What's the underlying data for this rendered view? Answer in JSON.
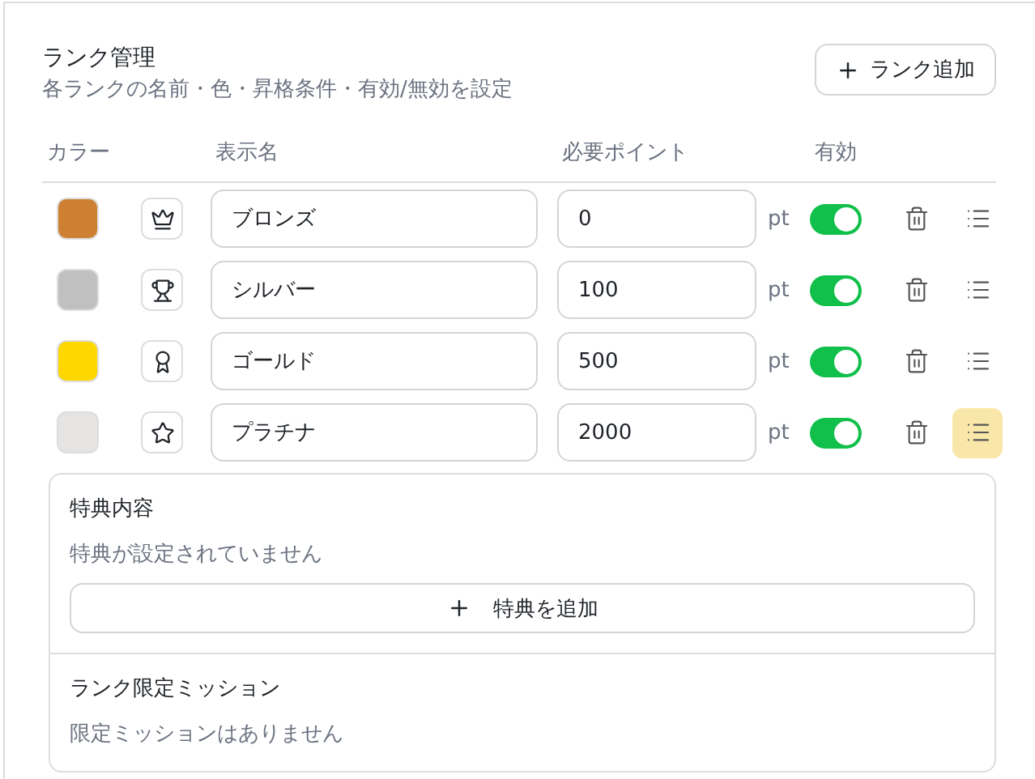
{
  "header": {
    "title": "ランク管理",
    "subtitle": "各ランクの名前・色・昇格条件・有効/無効を設定",
    "add_button": "ランク追加"
  },
  "columns": [
    "カラー",
    "表示名",
    "必要ポイント",
    "有効"
  ],
  "ranks": [
    {
      "color": "#cd8032",
      "name": "ブロンズ",
      "points": "0",
      "unit": "pt",
      "enabled": true,
      "expanded": false
    },
    {
      "color": "#c0c0c0",
      "name": "シルバー",
      "points": "100",
      "unit": "pt",
      "enabled": true,
      "expanded": false
    },
    {
      "color": "#ffd700",
      "name": "ゴールド",
      "points": "500",
      "unit": "pt",
      "enabled": true,
      "expanded": false
    },
    {
      "color": "#e5e4e2",
      "name": "プラチナ",
      "points": "2000",
      "unit": "pt",
      "enabled": true,
      "expanded": true
    }
  ],
  "detail": {
    "benefits_title": "特典内容",
    "benefits_empty": "特典が設定されていません",
    "add_benefit": "特典を追加",
    "missions_title": "ランク限定ミッション",
    "missions_empty": "限定ミッションはありません"
  }
}
